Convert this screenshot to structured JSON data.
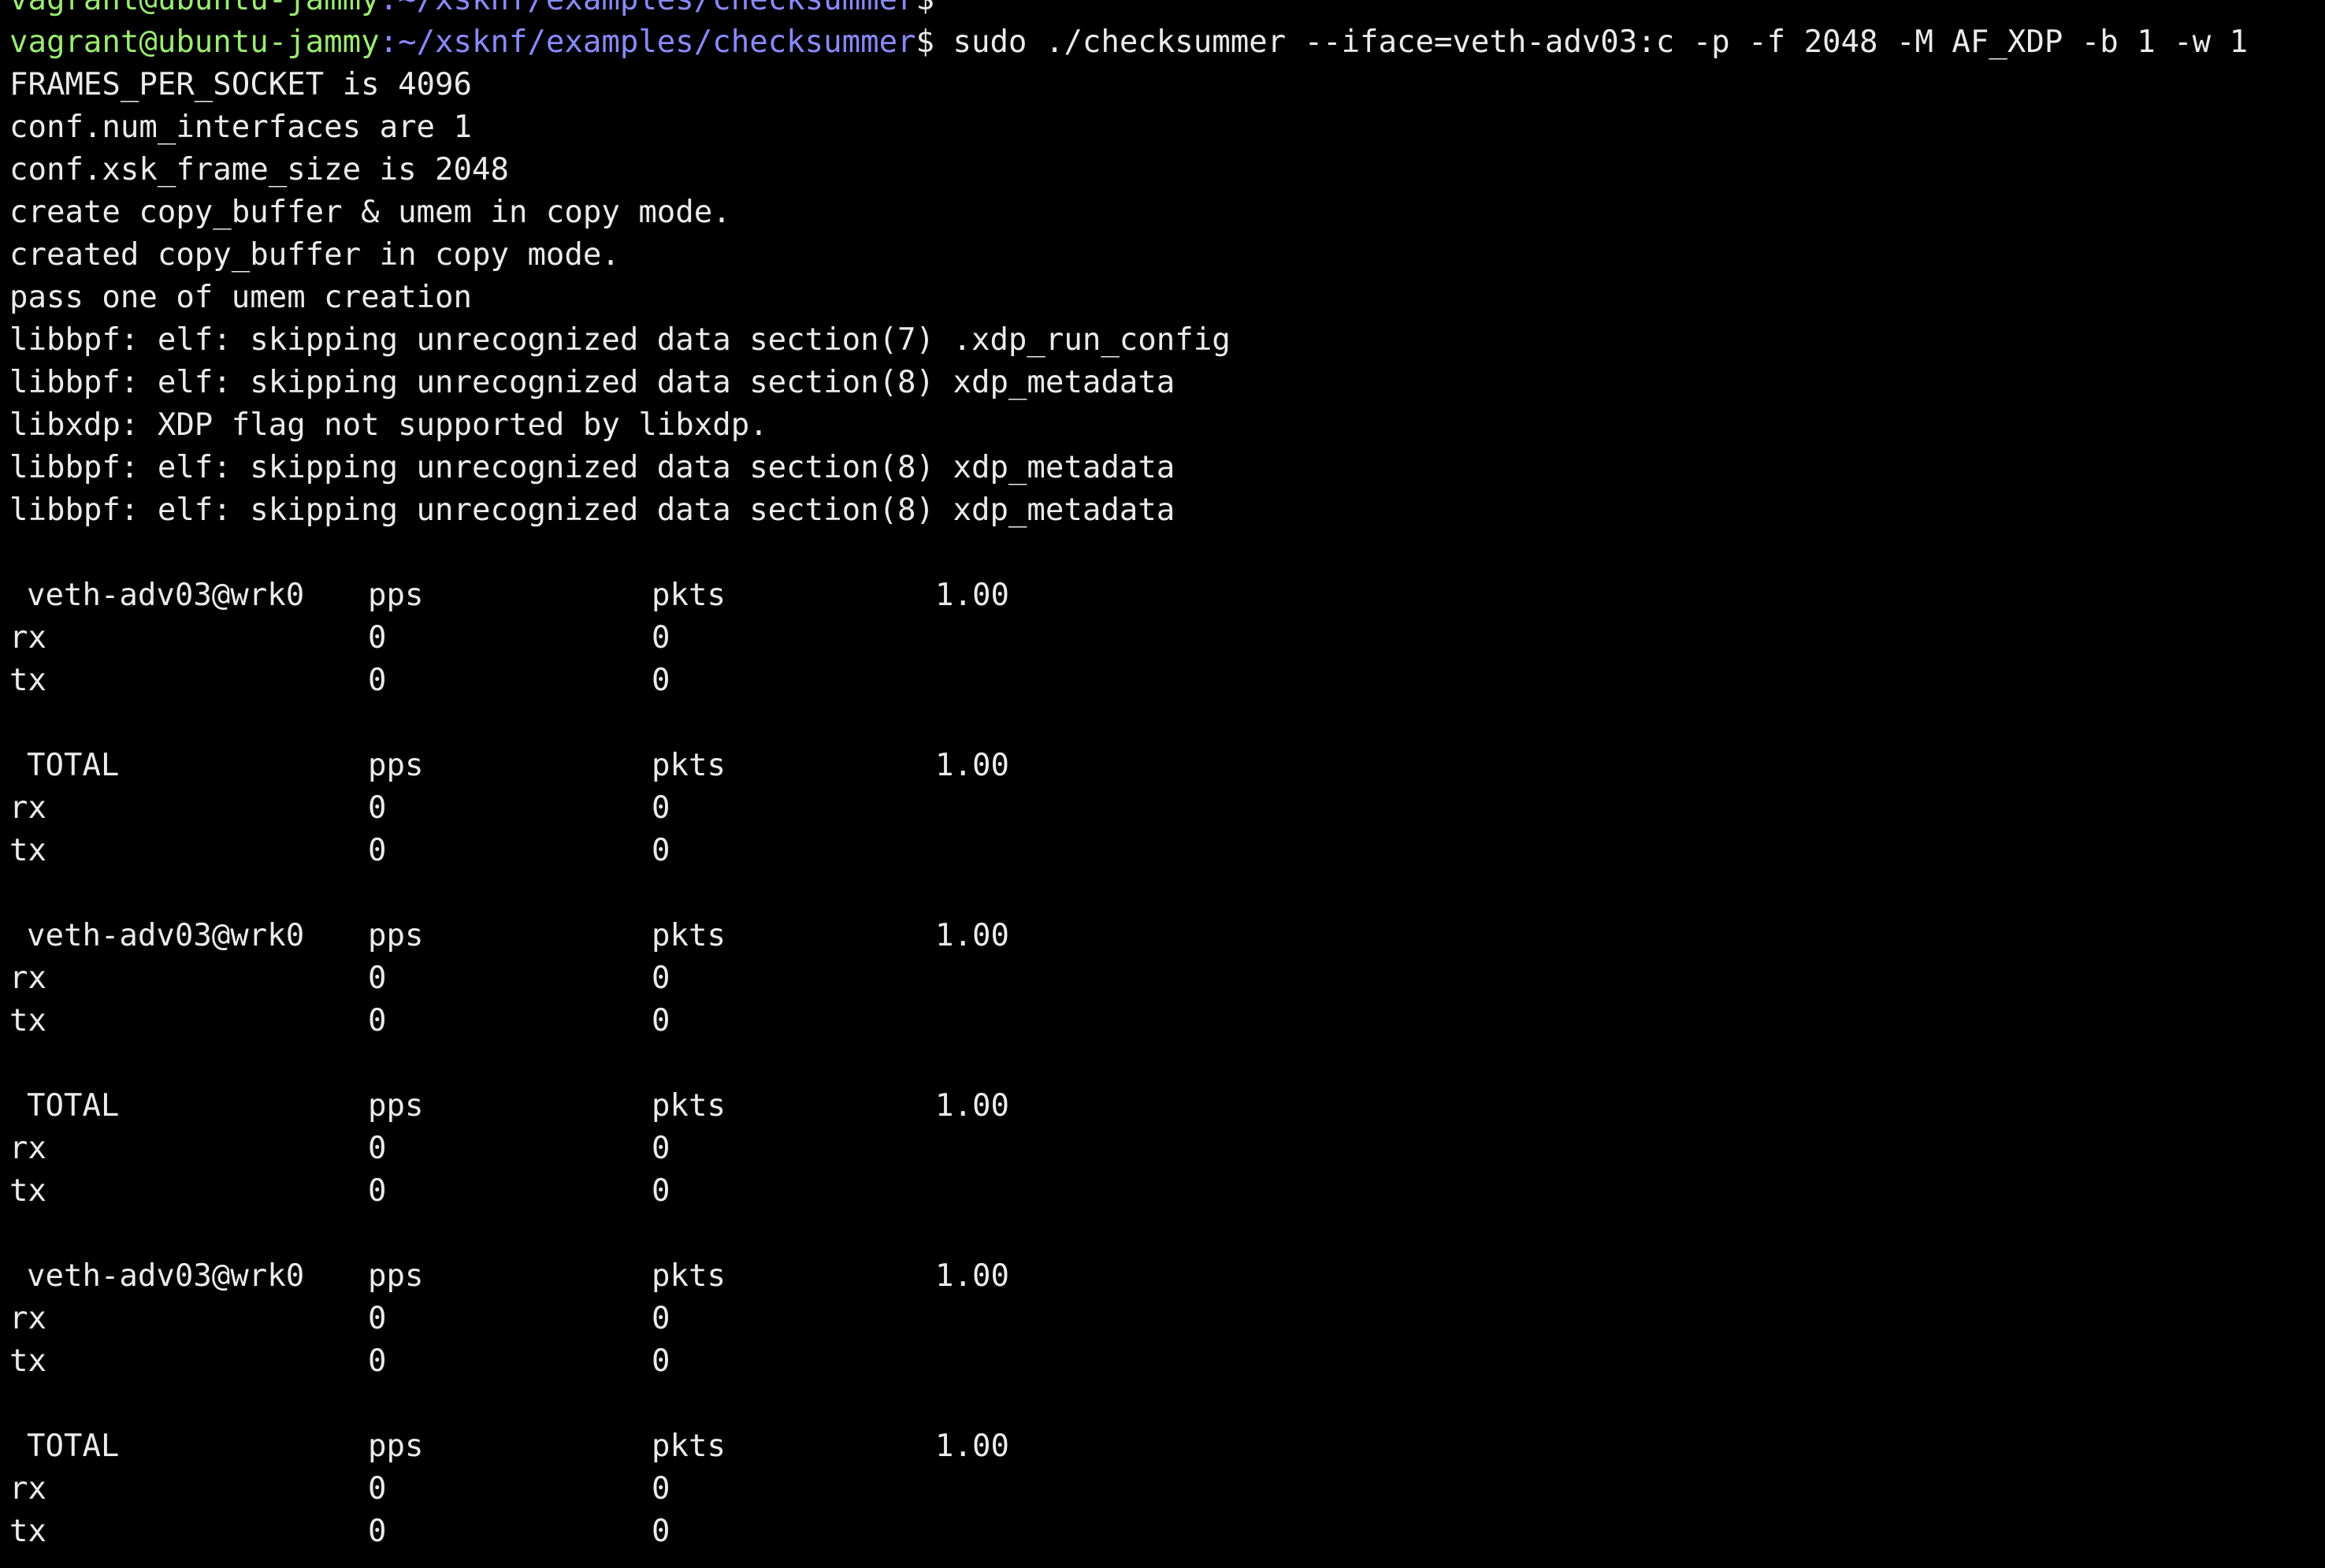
{
  "prompt_prev": {
    "user_host": "vagrant@ubuntu-jammy",
    "path": ":~/xsknf/examples/checksummer",
    "symbol": "$"
  },
  "prompt": {
    "user_host": "vagrant@ubuntu-jammy",
    "path": ":~/xsknf/examples/checksummer",
    "symbol": "$",
    "command": " sudo ./checksummer --iface=veth-adv03:c -p -f 2048 -M AF_XDP -b 1 -w 1"
  },
  "log_lines": [
    "FRAMES_PER_SOCKET is 4096",
    "conf.num_interfaces are 1",
    "conf.xsk_frame_size is 2048",
    "create copy_buffer & umem in copy mode.",
    "created copy_buffer in copy mode.",
    "pass one of umem creation",
    "libbpf: elf: skipping unrecognized data section(7) .xdp_run_config",
    "libbpf: elf: skipping unrecognized data section(8) xdp_metadata",
    "libxdp: XDP flag not supported by libxdp.",
    "libbpf: elf: skipping unrecognized data section(8) xdp_metadata",
    "libbpf: elf: skipping unrecognized data section(8) xdp_metadata"
  ],
  "stats_blocks": [
    {
      "header": {
        "name": "veth-adv03@wrk0",
        "col2": "pps",
        "col3": "pkts",
        "col4": "1.00"
      },
      "rx": {
        "label": "rx",
        "pps": "0",
        "pkts": "0"
      },
      "tx": {
        "label": "tx",
        "pps": "0",
        "pkts": "0"
      }
    },
    {
      "header": {
        "name": "TOTAL",
        "col2": "pps",
        "col3": "pkts",
        "col4": "1.00"
      },
      "rx": {
        "label": "rx",
        "pps": "0",
        "pkts": "0"
      },
      "tx": {
        "label": "tx",
        "pps": "0",
        "pkts": "0"
      }
    },
    {
      "header": {
        "name": "veth-adv03@wrk0",
        "col2": "pps",
        "col3": "pkts",
        "col4": "1.00"
      },
      "rx": {
        "label": "rx",
        "pps": "0",
        "pkts": "0"
      },
      "tx": {
        "label": "tx",
        "pps": "0",
        "pkts": "0"
      }
    },
    {
      "header": {
        "name": "TOTAL",
        "col2": "pps",
        "col3": "pkts",
        "col4": "1.00"
      },
      "rx": {
        "label": "rx",
        "pps": "0",
        "pkts": "0"
      },
      "tx": {
        "label": "tx",
        "pps": "0",
        "pkts": "0"
      }
    },
    {
      "header": {
        "name": "veth-adv03@wrk0",
        "col2": "pps",
        "col3": "pkts",
        "col4": "1.00"
      },
      "rx": {
        "label": "rx",
        "pps": "0",
        "pkts": "0"
      },
      "tx": {
        "label": "tx",
        "pps": "0",
        "pkts": "0"
      }
    },
    {
      "header": {
        "name": "TOTAL",
        "col2": "pps",
        "col3": "pkts",
        "col4": "1.00"
      },
      "rx": {
        "label": "rx",
        "pps": "0",
        "pkts": "0"
      },
      "tx": {
        "label": "tx",
        "pps": "0",
        "pkts": "0"
      }
    }
  ],
  "colors": {
    "background": "#000000",
    "text": "#ebebeb",
    "user_host": "#9bea72",
    "path": "#8a8aff"
  }
}
